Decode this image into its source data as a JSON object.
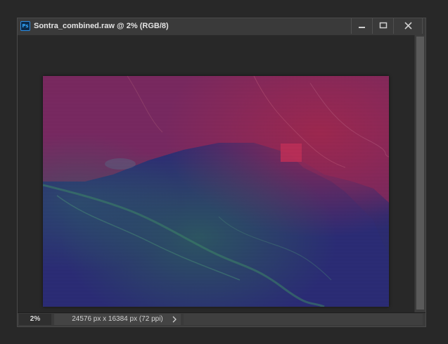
{
  "window": {
    "app_icon_label": "Ps",
    "title": "Sontra_combined.raw @ 2% (RGB/8)",
    "controls": [
      "minimize-icon",
      "maximize-icon",
      "close-icon"
    ]
  },
  "status": {
    "zoom": "2%",
    "document_info": "24576 px x 16384 px (72 ppi)"
  },
  "colors": {
    "app_bg": "#282828",
    "titlebar": "#3a3a3a",
    "photoshop_blue": "#31a8ff",
    "image_top": "#8e2a55",
    "image_bottom": "#2a2c72",
    "image_green_overlay": "#2f7a55"
  }
}
